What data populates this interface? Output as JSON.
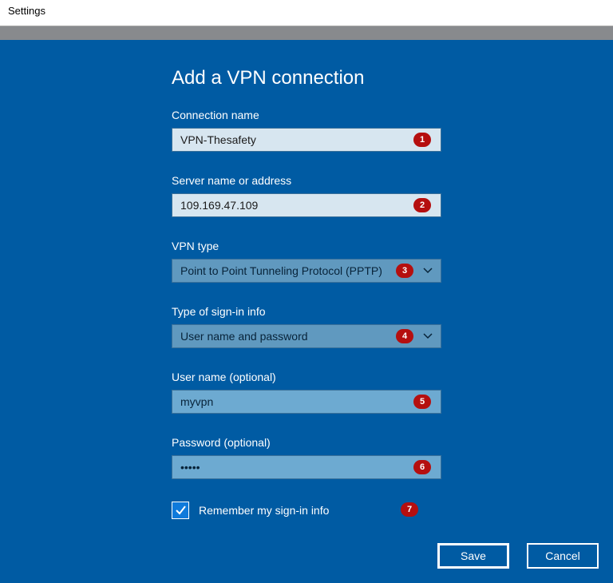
{
  "window": {
    "title": "Settings"
  },
  "heading": "Add a VPN connection",
  "labels": {
    "connectionName": "Connection name",
    "serverName": "Server name or address",
    "vpnType": "VPN type",
    "signInType": "Type of sign-in info",
    "userName": "User name (optional)",
    "password": "Password (optional)",
    "remember": "Remember my sign-in info"
  },
  "values": {
    "connectionName": "VPN-Thesafety",
    "serverName": "109.169.47.109",
    "vpnType": "Point to Point Tunneling Protocol (PPTP)",
    "signInType": "User name and password",
    "userName": "myvpn",
    "password": "•••••"
  },
  "badges": {
    "1": "1",
    "2": "2",
    "3": "3",
    "4": "4",
    "5": "5",
    "6": "6",
    "7": "7"
  },
  "buttons": {
    "save": "Save",
    "cancel": "Cancel"
  },
  "icons": {
    "chevronDown": "chevron-down-icon",
    "check": "check-icon"
  }
}
